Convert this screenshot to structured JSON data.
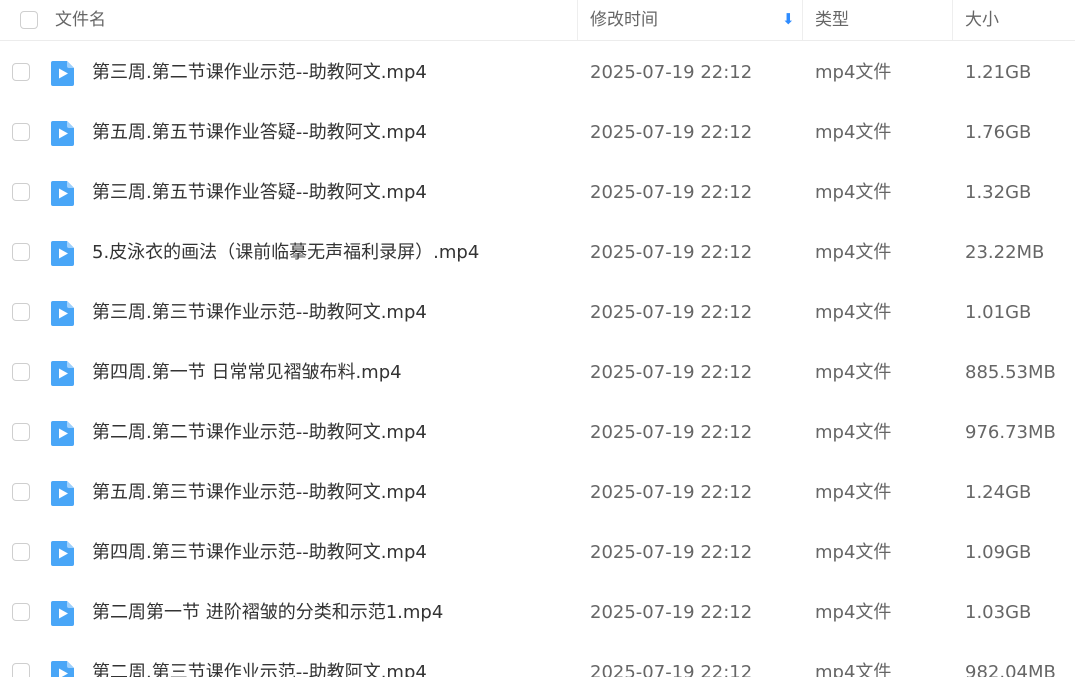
{
  "header": {
    "name_label": "文件名",
    "time_label": "修改时间",
    "sort_icon": "sort-down-icon",
    "type_label": "类型",
    "size_label": "大小"
  },
  "accent_color": "#2f8cff",
  "files": [
    {
      "name": "第三周.第二节课作业示范--助教阿文.mp4",
      "time": "2025-07-19 22:12",
      "type": "mp4文件",
      "size": "1.21GB"
    },
    {
      "name": "第五周.第五节课作业答疑--助教阿文.mp4",
      "time": "2025-07-19 22:12",
      "type": "mp4文件",
      "size": "1.76GB"
    },
    {
      "name": "第三周.第五节课作业答疑--助教阿文.mp4",
      "time": "2025-07-19 22:12",
      "type": "mp4文件",
      "size": "1.32GB"
    },
    {
      "name": "5.皮泳衣的画法（课前临摹无声福利录屏）.mp4",
      "time": "2025-07-19 22:12",
      "type": "mp4文件",
      "size": "23.22MB"
    },
    {
      "name": "第三周.第三节课作业示范--助教阿文.mp4",
      "time": "2025-07-19 22:12",
      "type": "mp4文件",
      "size": "1.01GB"
    },
    {
      "name": "第四周.第一节 日常常见褶皱布料.mp4",
      "time": "2025-07-19 22:12",
      "type": "mp4文件",
      "size": "885.53MB"
    },
    {
      "name": "第二周.第二节课作业示范--助教阿文.mp4",
      "time": "2025-07-19 22:12",
      "type": "mp4文件",
      "size": "976.73MB"
    },
    {
      "name": "第五周.第三节课作业示范--助教阿文.mp4",
      "time": "2025-07-19 22:12",
      "type": "mp4文件",
      "size": "1.24GB"
    },
    {
      "name": "第四周.第三节课作业示范--助教阿文.mp4",
      "time": "2025-07-19 22:12",
      "type": "mp4文件",
      "size": "1.09GB"
    },
    {
      "name": "第二周第一节 进阶褶皱的分类和示范1.mp4",
      "time": "2025-07-19 22:12",
      "type": "mp4文件",
      "size": "1.03GB"
    },
    {
      "name": "第二周.第三节课作业示范--助教阿文.mp4",
      "time": "2025-07-19 22:12",
      "type": "mp4文件",
      "size": "982.04MB"
    }
  ]
}
